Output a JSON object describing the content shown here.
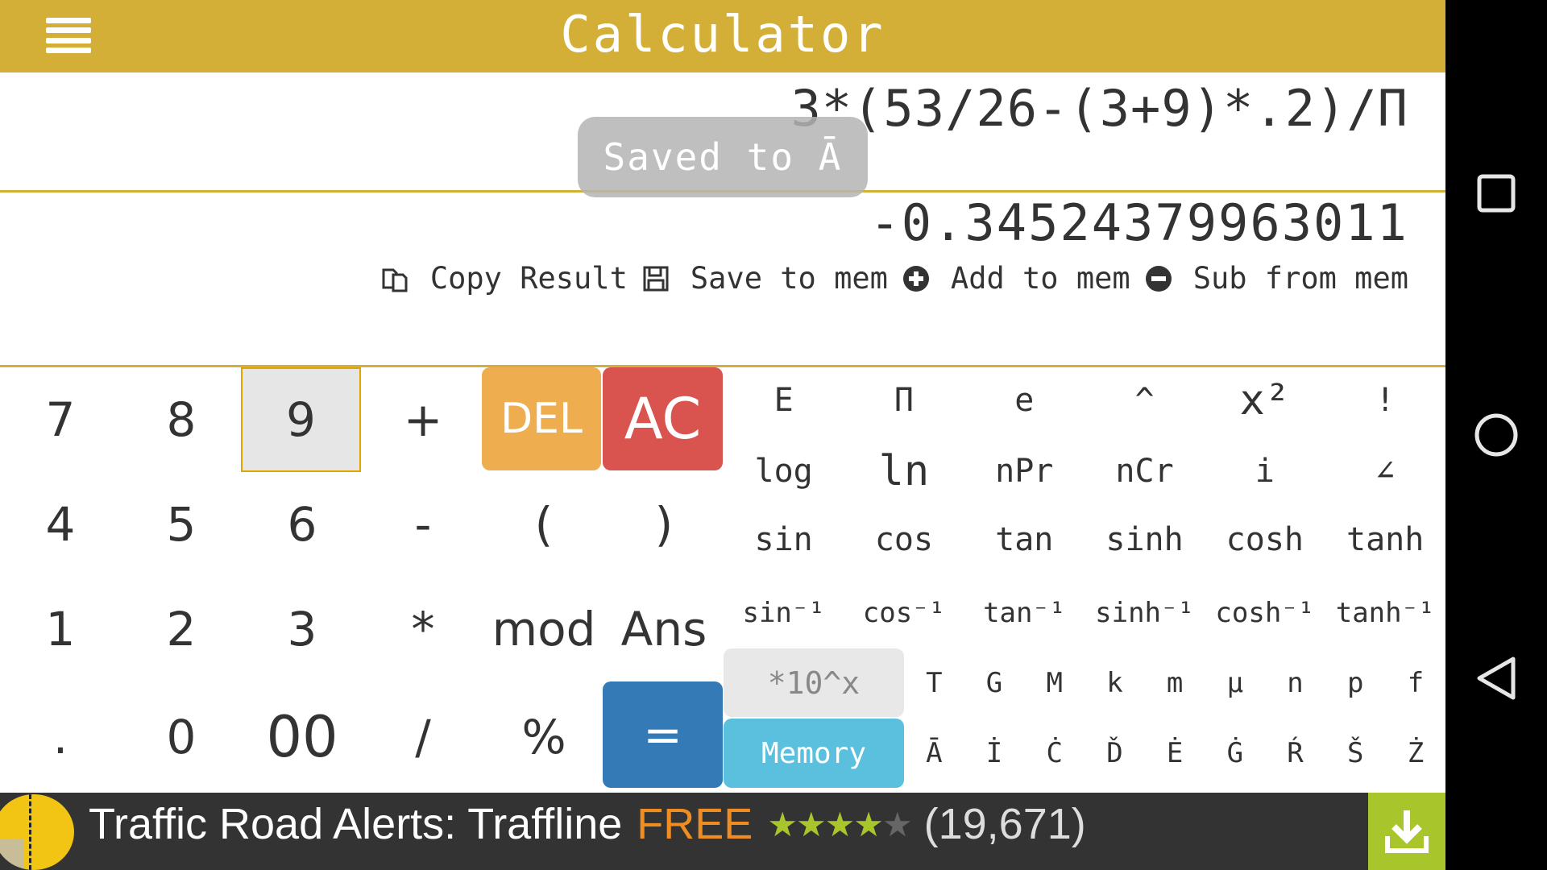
{
  "header": {
    "title": "Calculator"
  },
  "display": {
    "expression": "3*(53/26-(3+9)*.2)/Π",
    "result": "-0.34524379963011",
    "toast": "Saved to Ā"
  },
  "actions": [
    {
      "label": "Copy Result",
      "icon": "copy-icon"
    },
    {
      "label": "Save to mem",
      "icon": "save-icon"
    },
    {
      "label": "Add to mem",
      "icon": "plus-circle-icon"
    },
    {
      "label": "Sub from mem",
      "icon": "minus-circle-icon"
    }
  ],
  "keypad": {
    "rows": [
      [
        "7",
        "8",
        "9",
        "+"
      ],
      [
        "4",
        "5",
        "6",
        "-"
      ],
      [
        "1",
        "2",
        "3",
        "*"
      ],
      [
        ".",
        "0",
        "00",
        "/"
      ]
    ],
    "del": "DEL",
    "ac": "AC",
    "open_paren": "(",
    "close_paren": ")",
    "mod": "mod",
    "ans": "Ans",
    "percent": "%",
    "equals": "=",
    "selected_key": "9"
  },
  "scientific": {
    "row1": [
      "E",
      "Π",
      "e",
      "^",
      "x²",
      "!"
    ],
    "row2": [
      "log",
      "ln",
      "nPr",
      "nCr",
      "i",
      "∠"
    ],
    "row3": [
      "sin",
      "cos",
      "tan",
      "sinh",
      "cosh",
      "tanh"
    ],
    "row4": [
      "sin⁻¹",
      "cos⁻¹",
      "tan⁻¹",
      "sinh⁻¹",
      "cosh⁻¹",
      "tanh⁻¹"
    ],
    "exp_key": "*10^x",
    "memory_key": "Memory",
    "units": [
      "T",
      "G",
      "M",
      "k",
      "m",
      "μ",
      "n",
      "p",
      "f"
    ],
    "memory_vars": [
      "Ā",
      "İ",
      "Ċ",
      "Ď",
      "Ė",
      "Ġ",
      "Ŕ",
      "Š",
      "Ż"
    ]
  },
  "ad": {
    "title": "Traffic Road Alerts: Traffline",
    "price": "FREE",
    "rating": 4,
    "rating_max": 5,
    "reviews": "(19,671)",
    "download_icon": "download-icon"
  },
  "navbar": [
    "recents-icon",
    "home-icon",
    "back-icon"
  ],
  "colors": {
    "accent": "#D3AF37",
    "del": "#EEAD4E",
    "ac": "#D9534F",
    "equals": "#337AB7",
    "memory": "#5BC0DE",
    "ad_free": "#EF8C22",
    "ad_green": "#A8C62B"
  }
}
